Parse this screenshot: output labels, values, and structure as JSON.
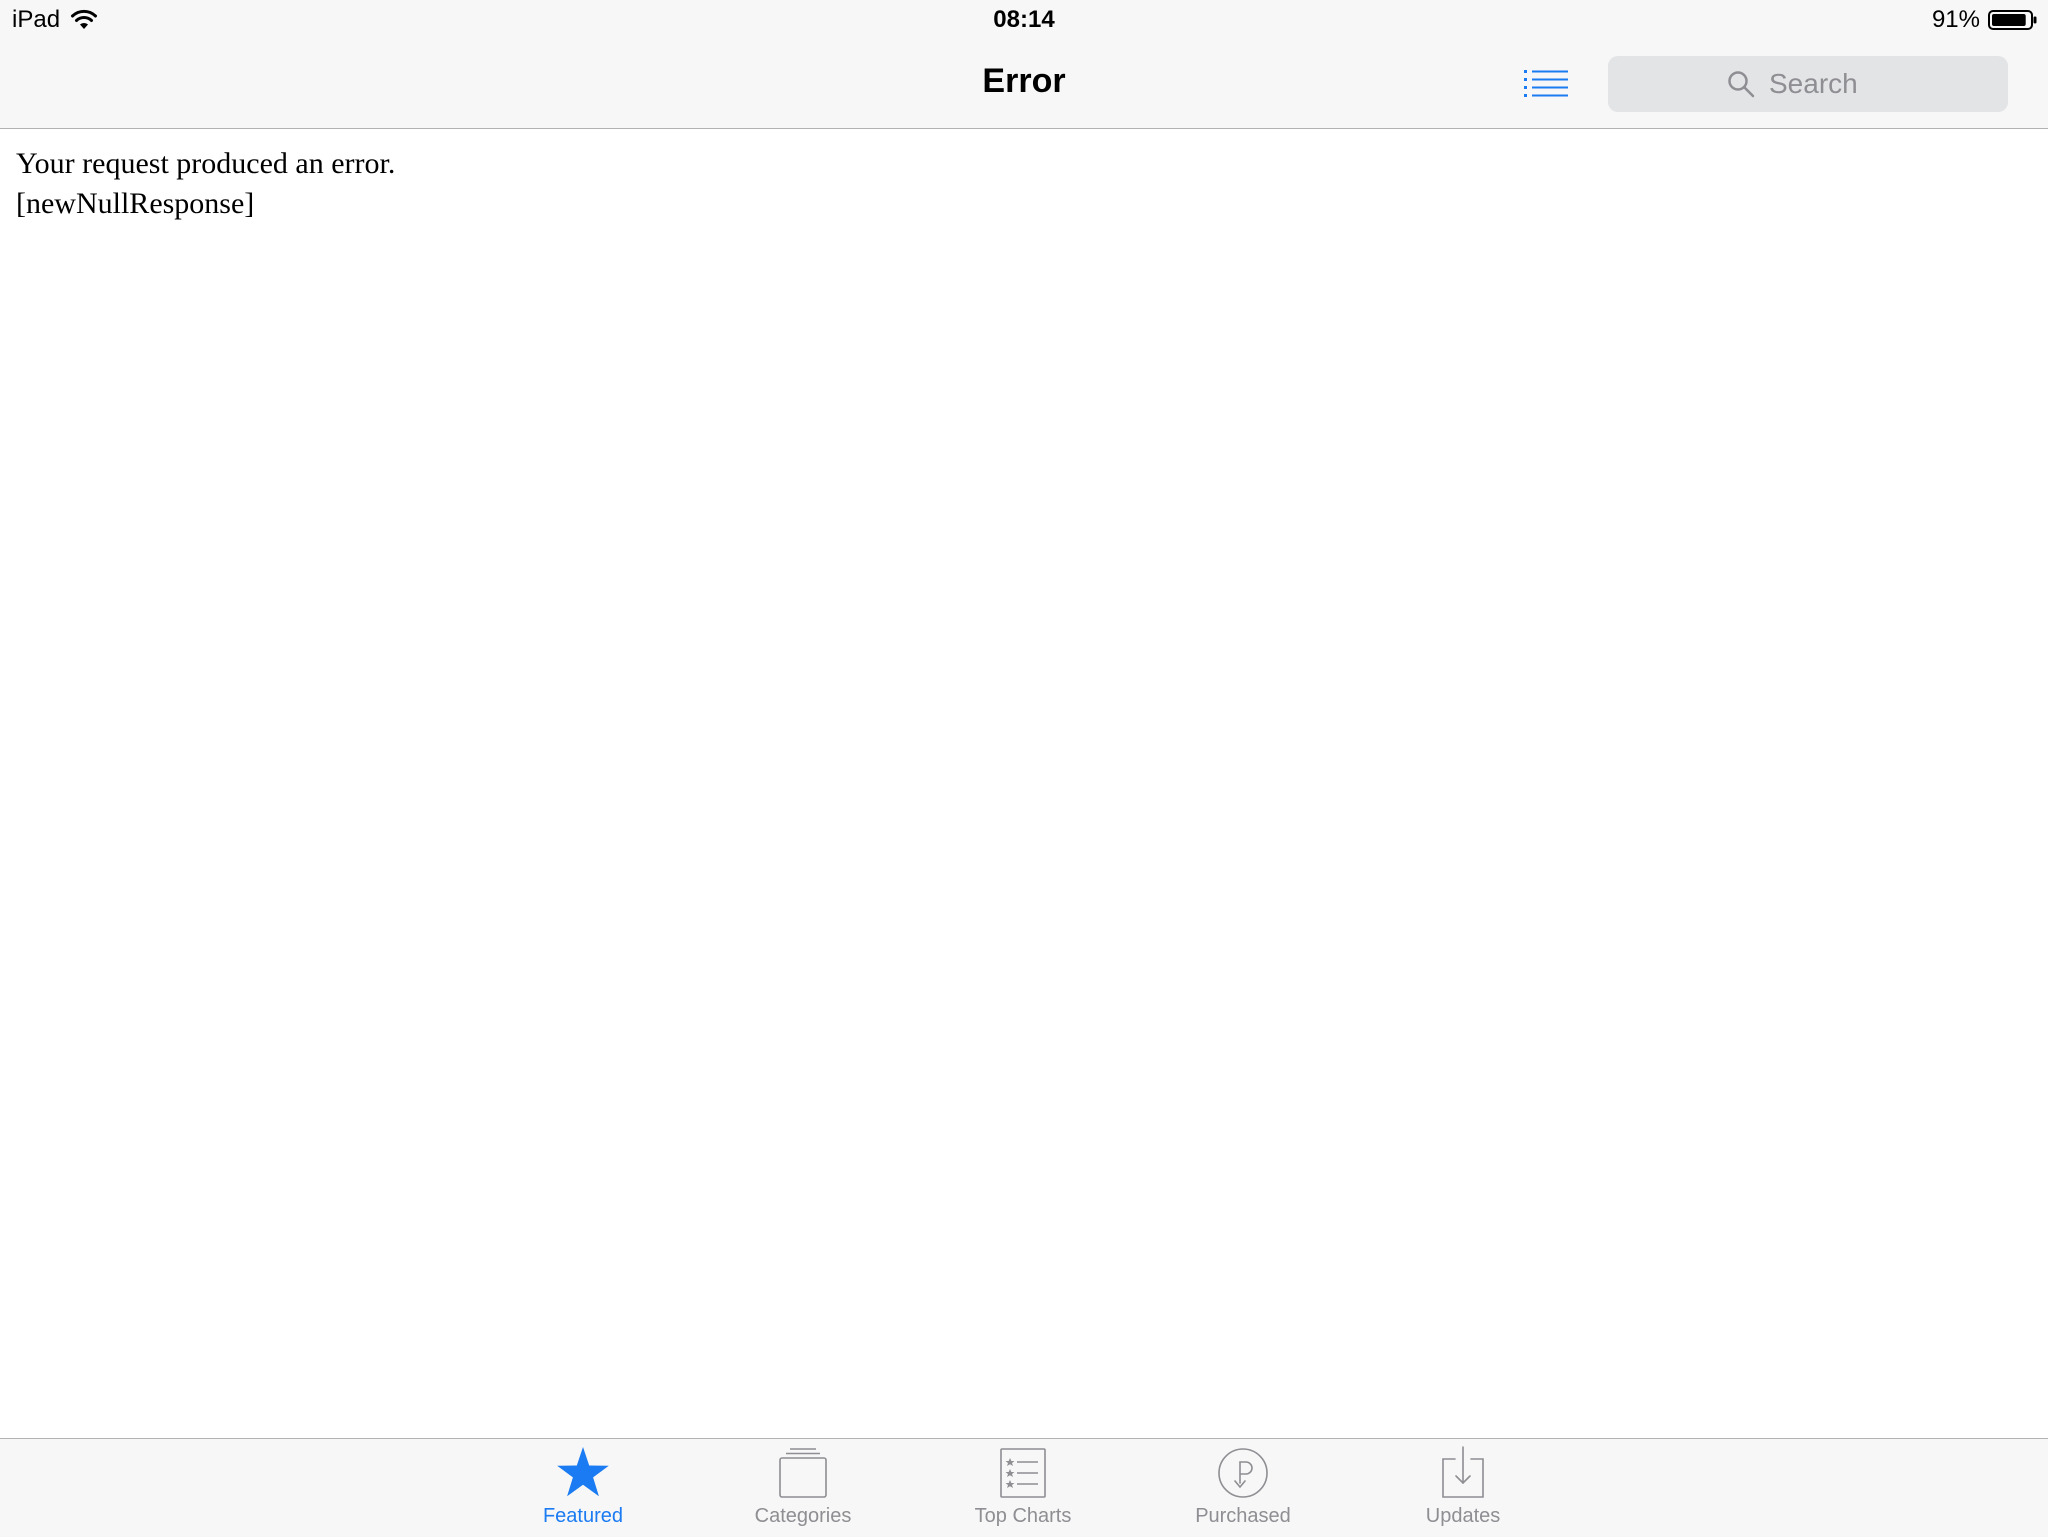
{
  "status_bar": {
    "device": "iPad",
    "time": "08:14",
    "battery": "91%",
    "battery_level": 0.91
  },
  "nav": {
    "title": "Error",
    "search_placeholder": "Search"
  },
  "content": {
    "line1": "Your request produced an error.",
    "line2": "[newNullResponse]"
  },
  "tabs": [
    {
      "label": "Featured",
      "icon": "star-icon",
      "active": true
    },
    {
      "label": "Categories",
      "icon": "categories-icon",
      "active": false
    },
    {
      "label": "Top Charts",
      "icon": "top-charts-icon",
      "active": false
    },
    {
      "label": "Purchased",
      "icon": "purchased-icon",
      "active": false
    },
    {
      "label": "Updates",
      "icon": "updates-icon",
      "active": false
    }
  ],
  "colors": {
    "accent": "#1a7bf2",
    "inactive": "#8e8e93",
    "bar_background": "#f7f7f7"
  }
}
